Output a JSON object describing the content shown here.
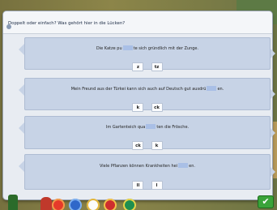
{
  "instruction": "Doppelt oder einfach? Was gehört hier in die Lücken?",
  "items": [
    {
      "before": "Die Katze pu",
      "after": "te sich gründlich mit der Zunge.",
      "options": [
        "z",
        "tz"
      ]
    },
    {
      "before": "Mein Freund aus der Türkei kann sich auch auf Deutsch gut ausdrü",
      "after": "en.",
      "options": [
        "k",
        "ck"
      ]
    },
    {
      "before": "Im Gartenteich qua",
      "after": "ten die Frösche.",
      "options": [
        "ck",
        "k"
      ]
    },
    {
      "before": "Viele Pflanzen können Krankheiten hei",
      "after": "en.",
      "options": [
        "ll",
        "l"
      ]
    }
  ],
  "icons": {
    "check": "✔"
  },
  "colors": {
    "panel": "#e8ecf2",
    "card": "#c7d3e6",
    "gap": "#a9bfe6",
    "check_button": "#3aa33a"
  }
}
